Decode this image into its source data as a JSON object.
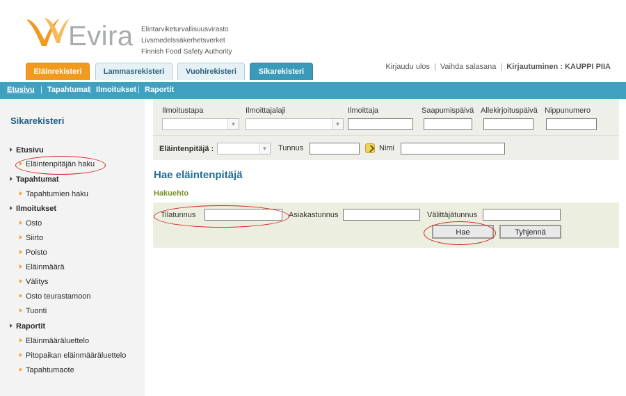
{
  "header": {
    "logo_text": "Evira",
    "agency_lines": [
      "Elintarviketurvallisuusvirasto",
      "Livsmedelssäkerhetsverket",
      "Finnish Food Safety Authority"
    ],
    "tabs": [
      {
        "label": "Eläinrekisteri"
      },
      {
        "label": "Lammasrekisteri"
      },
      {
        "label": "Vuohirekisteri"
      },
      {
        "label": "Sikarekisteri"
      }
    ],
    "links": {
      "logout": "Kirjaudu ulos",
      "change_password": "Vaihda salasana",
      "login_info": "Kirjautuminen : KAUPPI PIIA"
    },
    "colors": {
      "orange": "#f29a1f",
      "blue": "#3fa1c0"
    }
  },
  "nav": {
    "items": [
      "Etusivu",
      "Tapahtumat",
      "Ilmoitukset",
      "Raportit"
    ]
  },
  "sidebar": {
    "title": "Sikarekisteri",
    "groups": [
      {
        "label": "Etusivu",
        "children": [
          "Eläintenpitäjän haku"
        ]
      },
      {
        "label": "Tapahtumat",
        "children": [
          "Tapahtumien haku"
        ]
      },
      {
        "label": "Ilmoitukset",
        "children": [
          "Osto",
          "Siirto",
          "Poisto",
          "Eläinmäärä",
          "Välitys",
          "Osto teurastamoon",
          "Tuonti"
        ]
      },
      {
        "label": "Raportit",
        "children": [
          "Eläinmääräluettelo",
          "Pitopaikan eläinmääräluettelo",
          "Tapahtumaote"
        ]
      }
    ]
  },
  "filter": {
    "ilmoitustapa": "Ilmoitustapa",
    "ilmoittajalaji": "Ilmoittajalaji",
    "ilmoittaja": "Ilmoittaja",
    "saapumispaiva": "Saapumispäivä",
    "allekirjoituspaiva": "Allekirjoituspäivä",
    "nippunumero": "Nippunumero",
    "elaintenpitaja": "Eläintenpitäjä :",
    "tunnus": "Tunnus",
    "nimi": "Nimi"
  },
  "main": {
    "title": "Hae eläintenpitäjä",
    "subhead": "Hakuehto",
    "tilatunnus": "Tilatunnus",
    "asiakastunnus": "Asiakastunnus",
    "valittajatunnus": "Välittäjätunnus",
    "search_button": "Hae",
    "clear_button": "Tyhjennä"
  }
}
